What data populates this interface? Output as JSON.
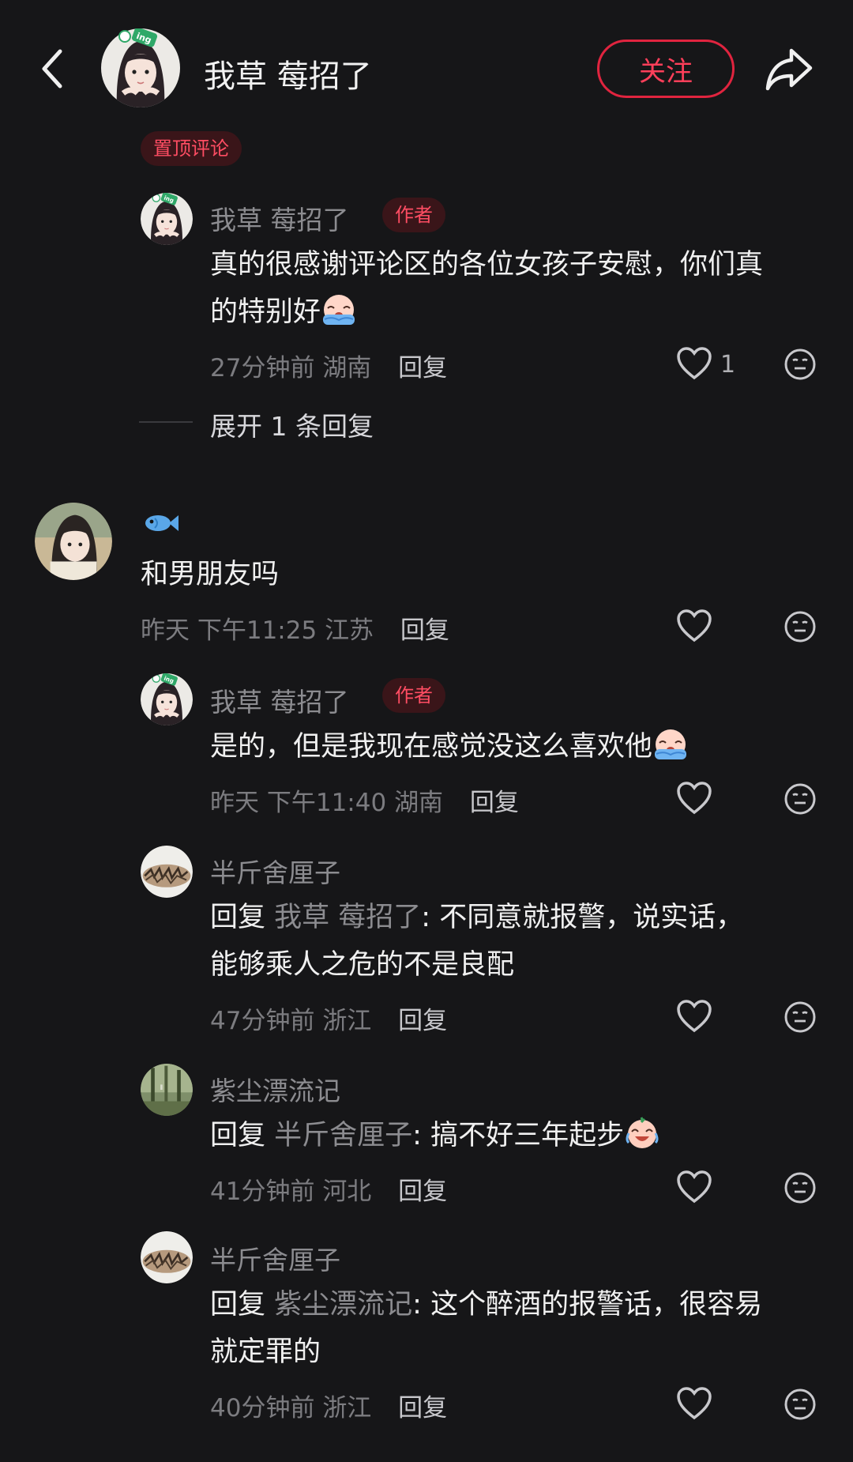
{
  "header": {
    "title": "我草 莓招了",
    "follow_label": "关注"
  },
  "pinned_label": "置顶评论",
  "author_tag": "作者",
  "colors": {
    "accent": "#ff3f5a",
    "background": "#161618"
  },
  "comments": [
    {
      "name": "我草 莓招了",
      "line1": "真的很感谢评论区的各位女孩子安慰，你们真",
      "line2": "的特别好",
      "emoji": "crying-face",
      "time": "27分钟前",
      "location": "湖南",
      "reply_label": "回复",
      "likes": "1"
    },
    {
      "expand_label": "展开 1 条回复"
    },
    {
      "name_emoji": "fish-icon",
      "line1": "和男朋友吗",
      "time": "昨天 下午11:25",
      "location": "江苏",
      "reply_label": "回复"
    },
    {
      "name": "我草 莓招了",
      "line1": "是的，但是我现在感觉没这么喜欢他",
      "emoji": "crying-face",
      "time": "昨天 下午11:40",
      "location": "湖南",
      "reply_label": "回复"
    },
    {
      "name": "半斤舍厘子",
      "reply_prefix": "回复",
      "reply_to": "我草 莓招了",
      "line1": ": 不同意就报警，说实话，",
      "line2": "能够乘人之危的不是良配",
      "time": "47分钟前",
      "location": "浙江",
      "reply_label": "回复"
    },
    {
      "name": "紫尘漂流记",
      "reply_prefix": "回复",
      "reply_to": "半斤舍厘子",
      "line1": ": 搞不好三年起步",
      "emoji": "laugh-cry-face",
      "time": "41分钟前",
      "location": "河北",
      "reply_label": "回复"
    },
    {
      "name": "半斤舍厘子",
      "reply_prefix": "回复",
      "reply_to": "紫尘漂流记",
      "line1": ": 这个醉酒的报警话，很容易",
      "line2": "就定罪的",
      "time": "40分钟前",
      "location": "浙江",
      "reply_label": "回复"
    }
  ]
}
